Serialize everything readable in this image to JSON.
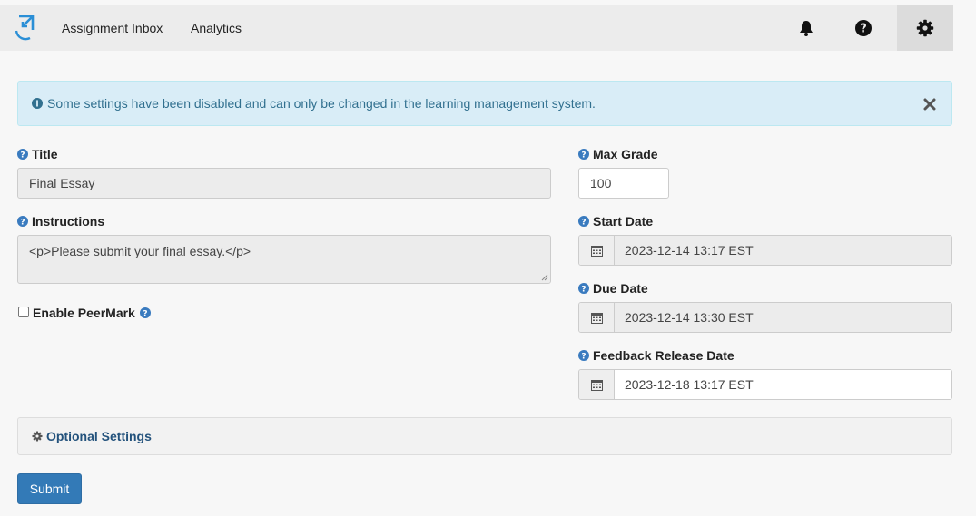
{
  "nav": {
    "links": [
      "Assignment Inbox",
      "Analytics"
    ],
    "logo_color": "#2b8fd6"
  },
  "alert": {
    "message": "Some settings have been disabled and can only be changed in the learning management system."
  },
  "form": {
    "title": {
      "label": "Title",
      "value": "Final Essay"
    },
    "instructions": {
      "label": "Instructions",
      "value": "<p>Please submit your final essay.</p>"
    },
    "peermark": {
      "label": "Enable PeerMark",
      "checked": false
    },
    "max_grade": {
      "label": "Max Grade",
      "value": "100"
    },
    "start_date": {
      "label": "Start Date",
      "value": "2023-12-14 13:17 EST"
    },
    "due_date": {
      "label": "Due Date",
      "value": "2023-12-14 13:30 EST"
    },
    "feedback_date": {
      "label": "Feedback Release Date",
      "value": "2023-12-18 13:17 EST"
    },
    "optional_settings": "Optional Settings",
    "submit": "Submit"
  },
  "colors": {
    "primary": "#337ab7",
    "help_icon": "#3a7bbf",
    "alert_bg": "#d9edf7",
    "alert_text": "#31708f"
  }
}
